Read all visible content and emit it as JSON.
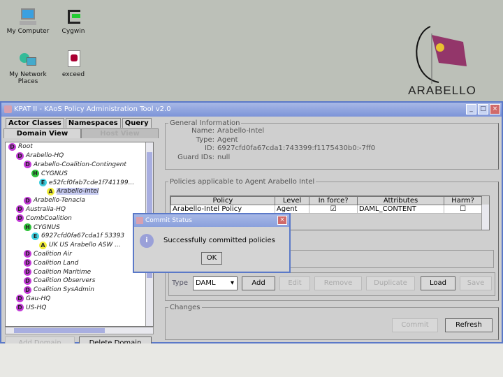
{
  "desktop": {
    "icons": [
      {
        "label": "My Computer"
      },
      {
        "label": "Cygwin"
      },
      {
        "label": "My Network Places"
      },
      {
        "label": "exceed"
      }
    ],
    "logo_text": "ARABELLO"
  },
  "window": {
    "title": "KPAT II - KAoS Policy Administration Tool v2.0",
    "left": {
      "tabs": [
        "Actor Classes",
        "Namespaces",
        "Query"
      ],
      "subtabs": [
        "Domain View",
        "Host View"
      ],
      "tree": [
        {
          "label": "Root",
          "type": "D",
          "depth": 0
        },
        {
          "label": "Arabello-HQ",
          "type": "D",
          "depth": 1
        },
        {
          "label": "Arabello-Coalition-Contingent",
          "type": "D",
          "depth": 2
        },
        {
          "label": "CYGNUS",
          "type": "H",
          "depth": 3
        },
        {
          "label": "e52fcf0fab7cde1f741199...",
          "type": "E",
          "depth": 4
        },
        {
          "label": "Arabello-Intel",
          "type": "A",
          "depth": 5,
          "selected": true
        },
        {
          "label": "Arabello-Tenacia",
          "type": "D",
          "depth": 2
        },
        {
          "label": "Australia-HQ",
          "type": "D",
          "depth": 1
        },
        {
          "label": "CombCoalition",
          "type": "D",
          "depth": 1
        },
        {
          "label": "CYGNUS",
          "type": "H",
          "depth": 2
        },
        {
          "label": "6927cfd0fa67cda1f 53393",
          "type": "E",
          "depth": 3
        },
        {
          "label": "UK US Arabello ASW ...",
          "type": "A",
          "depth": 4
        },
        {
          "label": "Coalition Air",
          "type": "D",
          "depth": 2
        },
        {
          "label": "Coalition Land",
          "type": "D",
          "depth": 2
        },
        {
          "label": "Coalition Maritime",
          "type": "D",
          "depth": 2
        },
        {
          "label": "Coalition Observers",
          "type": "D",
          "depth": 2
        },
        {
          "label": "Coalition SysAdmin",
          "type": "D",
          "depth": 2
        },
        {
          "label": "Gau-HQ",
          "type": "D",
          "depth": 1
        },
        {
          "label": "US-HQ",
          "type": "D",
          "depth": 1
        }
      ],
      "add_domain": "Add Domain",
      "delete_domain": "Delete Domain"
    },
    "general": {
      "legend": "General Information",
      "name_k": "Name:",
      "name": "Arabello-Intel",
      "type_k": "Type:",
      "type": "Agent",
      "id_k": "ID:",
      "id": "6927cfd0fa67cda1:743399:f1175430b0:-7ff0",
      "guard_k": "Guard IDs:",
      "guard": "null"
    },
    "policies": {
      "legend": "Policies applicable to Agent Arabello Intel",
      "columns": [
        "Policy",
        "Level",
        "In force?",
        "Attributes",
        "Harm?"
      ],
      "rows": [
        {
          "policy": "Arabello-Intel Policy",
          "level": "Agent",
          "in_force": true,
          "attributes": "DAML_CONTENT",
          "harm": false
        }
      ],
      "type_label": "Type",
      "type_value": "DAML",
      "buttons": {
        "add": "Add",
        "edit": "Edit",
        "remove": "Remove",
        "duplicate": "Duplicate",
        "load": "Load",
        "save": "Save"
      }
    },
    "changes": {
      "legend": "Changes",
      "commit": "Commit",
      "refresh": "Refresh"
    }
  },
  "dialog": {
    "title": "Commit Status",
    "message": "Successfully committed policies",
    "ok": "OK"
  }
}
